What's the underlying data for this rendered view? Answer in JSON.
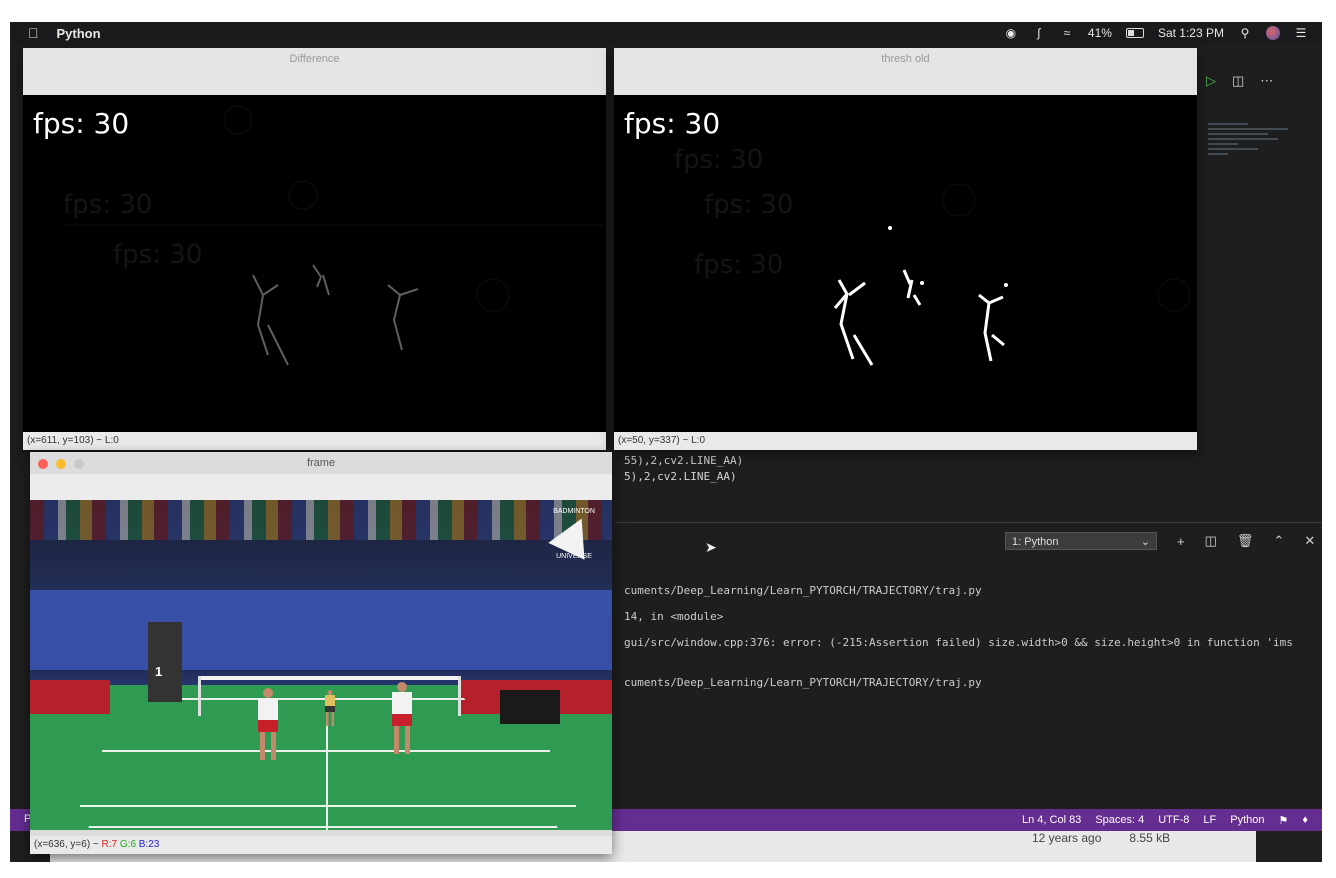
{
  "menubar": {
    "app_name": "Python",
    "battery": "41%",
    "clock": "Sat 1:23 PM"
  },
  "windows": {
    "difference": {
      "title": "Difference",
      "overlay": "fps: 30",
      "status": "(x=611, y=103) ~ L:0"
    },
    "threshold": {
      "title": "thresh old",
      "overlay": "fps: 30",
      "status": "(x=50, y=337) ~ L:0"
    },
    "frame": {
      "title": "frame",
      "status_coords": "(x=636, y=6) ~",
      "status_r": "R:7",
      "status_g": "G:6",
      "status_b": "B:23",
      "logo_top": "BADMINTON",
      "logo_bottom": "UNIVERSE"
    }
  },
  "editor": {
    "lines": [
      "55),2,cv2.LINE_AA)",
      "5),2,cv2.LINE_AA)"
    ]
  },
  "terminal": {
    "selector": "1: Python",
    "lines": [
      "cuments/Deep_Learning/Learn_PYTORCH/TRAJECTORY/traj.py",
      "14, in <module>",
      "gui/src/window.cpp:376: error: (-215:Assertion failed) size.width>0 && size.height>0 in function 'ims",
      "cuments/Deep_Learning/Learn_PYTORCH/TRAJECTORY/traj.py"
    ]
  },
  "statusbar": {
    "left": "P",
    "position": "Ln 4, Col 83",
    "spaces": "Spaces: 4",
    "encoding": "UTF-8",
    "eol": "LF",
    "language": "Python"
  },
  "file_meta": {
    "age": "12 years ago",
    "size": "8.55 kB"
  }
}
